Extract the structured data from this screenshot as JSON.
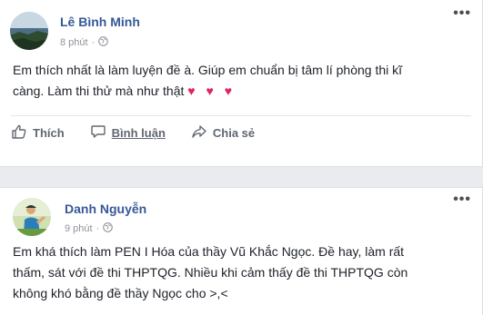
{
  "posts": [
    {
      "author": "Lê Bình Minh",
      "time": "8 phút",
      "privacy_icon": "globe-icon",
      "menu": "•••",
      "text_line1": "Em thích nhất là làm luyện đề à. Giúp em chuẩn bị tâm lí phòng thi kĩ",
      "text_line2": "càng. Làm thi thử mà như thật",
      "hearts": "♥ ♥ ♥",
      "actions": {
        "like": "Thích",
        "comment": "Bình luận",
        "share": "Chia sẻ"
      }
    },
    {
      "author": "Danh Nguyễn",
      "time": "9 phút",
      "privacy_icon": "globe-icon",
      "menu": "•••",
      "text_line1": "Em khá thích làm PEN I Hóa của thầy Vũ Khắc Ngọc. Đề hay, làm rất",
      "text_line2": "thấm, sát với đề thi THPTQG. Nhiều khi cảm thấy đề thi THPTQG còn",
      "text_line3": "không khó bằng đề thầy Ngọc cho >,<"
    }
  ],
  "colors": {
    "author_name": "#365899",
    "meta": "#90949c",
    "heart": "#e0245e",
    "background": "#e9ebee"
  }
}
